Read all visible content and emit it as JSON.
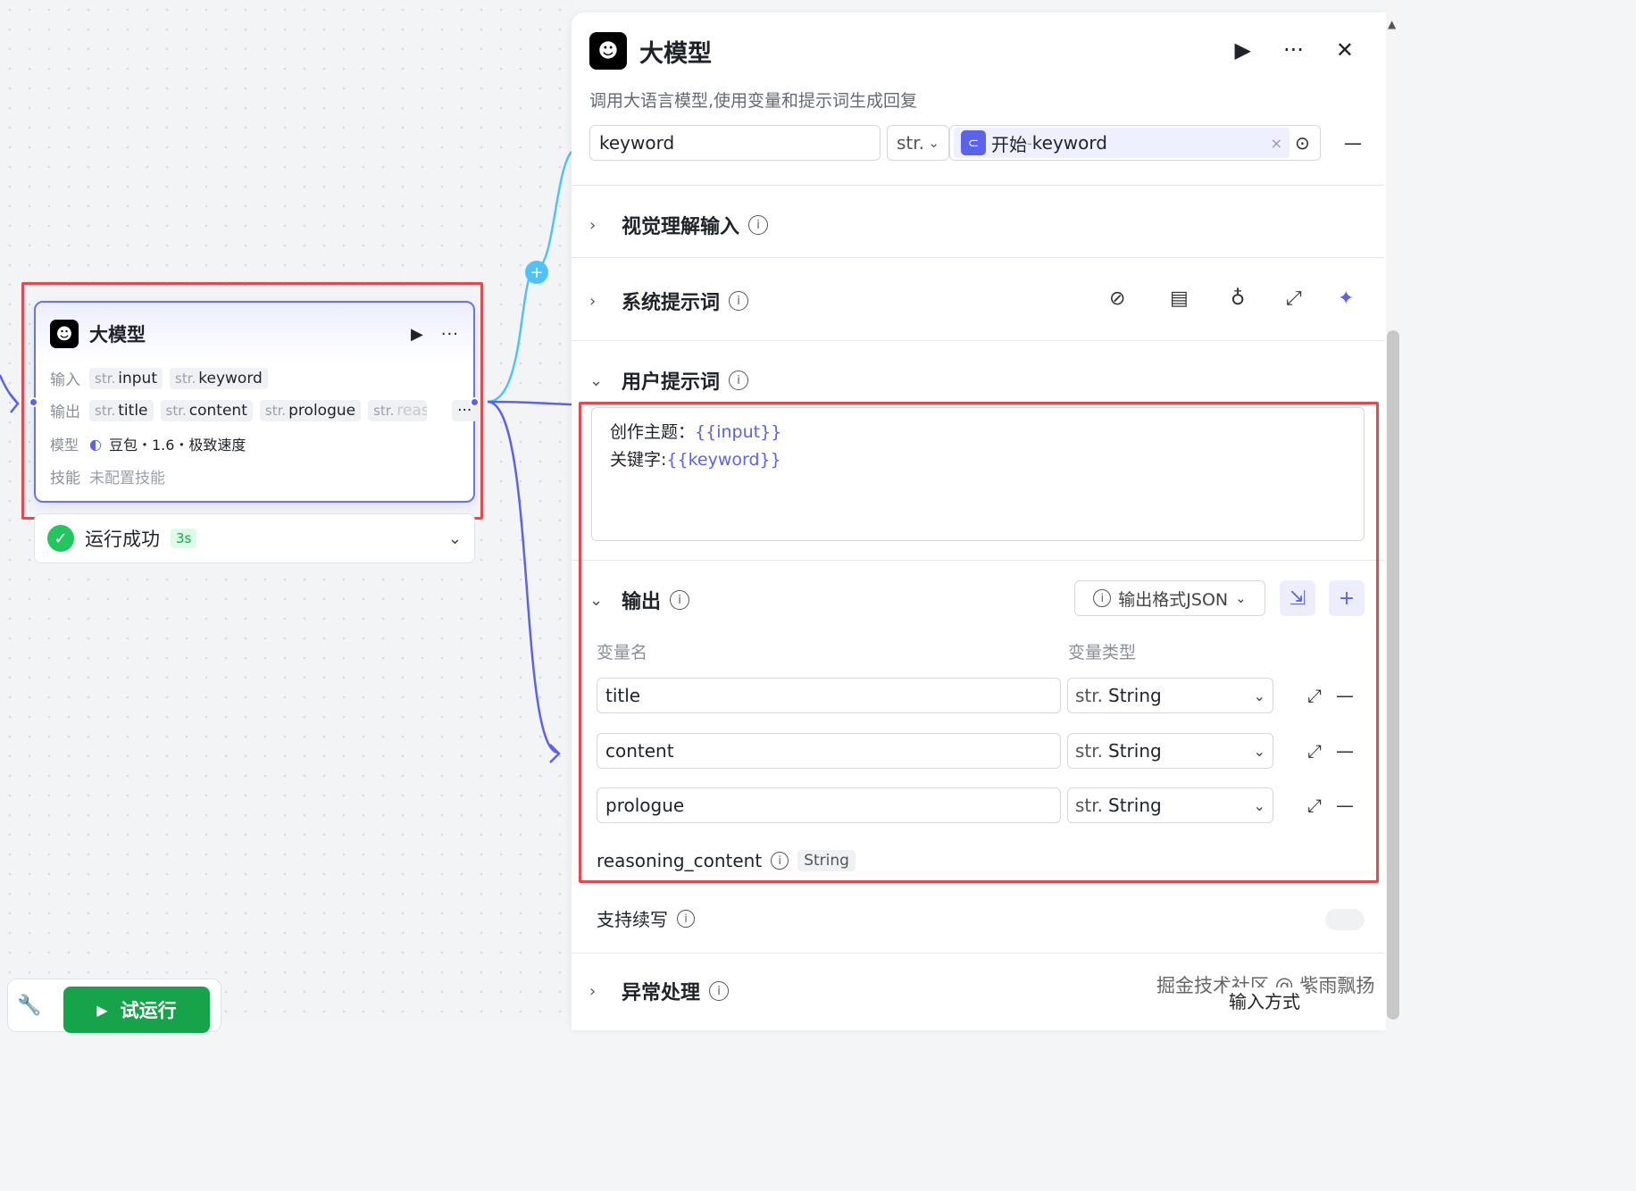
{
  "node": {
    "title": "大模型",
    "input_label": "输入",
    "inputs": [
      {
        "type": "str.",
        "name": "input"
      },
      {
        "type": "str.",
        "name": "keyword"
      }
    ],
    "output_label": "输出",
    "outputs": [
      {
        "type": "str.",
        "name": "title"
      },
      {
        "type": "str.",
        "name": "content"
      },
      {
        "type": "str.",
        "name": "prologue"
      },
      {
        "type": "str.",
        "name": "reas"
      }
    ],
    "more": "···",
    "model_label": "模型",
    "model_value": "豆包・1.6・极致速度",
    "skill_label": "技能",
    "skill_value": "未配置技能"
  },
  "status": {
    "text": "运行成功",
    "time": "3s"
  },
  "bottom": {
    "run_label": "试运行"
  },
  "panel": {
    "title": "大模型",
    "description": "调用大语言模型,使用变量和提示词生成回复",
    "input_row": {
      "name": "keyword",
      "type": "str.",
      "ref_source": "开始",
      "ref_sep": " - ",
      "ref_var": "keyword",
      "clear": "×"
    },
    "sections": {
      "vision": "视觉理解输入",
      "system": "系统提示词",
      "user": "用户提示词",
      "output": "输出",
      "continue": "支持续写",
      "exception": "异常处理"
    },
    "prompt": {
      "line1_prefix": "创作主题：",
      "line1_var": "{{input}}",
      "line2_prefix": "关键字:",
      "line2_var": "{{keyword}}"
    },
    "output_format": "输出格式JSON",
    "col_name": "变量名",
    "col_type": "变量类型",
    "outputs": [
      {
        "name": "title",
        "type_prefix": "str.",
        "type": "String"
      },
      {
        "name": "content",
        "type_prefix": "str.",
        "type": "String"
      },
      {
        "name": "prologue",
        "type_prefix": "str.",
        "type": "String"
      }
    ],
    "reasoning": {
      "name": "reasoning_content",
      "type": "String"
    }
  },
  "watermark": "掘金技术社区 @ 紫雨飘扬",
  "input_method": "输入方式",
  "colors": {
    "accent": "#5b63e8",
    "success": "#22c55e",
    "highlight": "#e5484d",
    "edge": "#4fc3f7"
  }
}
